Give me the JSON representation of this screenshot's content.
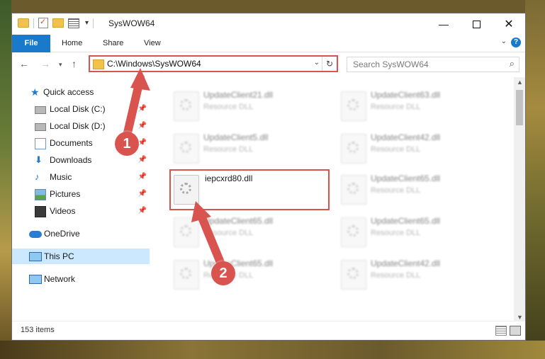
{
  "window": {
    "title": "SysWOW64"
  },
  "ribbon": {
    "tabs": [
      "File",
      "Home",
      "Share",
      "View"
    ],
    "help": "?"
  },
  "address_bar": {
    "path": "C:\\Windows\\SysWOW64"
  },
  "search": {
    "placeholder": "Search SysWOW64"
  },
  "nav_pane": {
    "items": [
      {
        "label": "Quick access",
        "icon": "star-icon",
        "pinned": false
      },
      {
        "label": "Local Disk (C:)",
        "icon": "disk-icon",
        "pinned": true
      },
      {
        "label": "Local Disk (D:)",
        "icon": "disk-icon",
        "pinned": true
      },
      {
        "label": "Documents",
        "icon": "document-icon",
        "pinned": true
      },
      {
        "label": "Downloads",
        "icon": "download-icon",
        "pinned": true
      },
      {
        "label": "Music",
        "icon": "music-icon",
        "pinned": true
      },
      {
        "label": "Pictures",
        "icon": "pictures-icon",
        "pinned": true
      },
      {
        "label": "Videos",
        "icon": "videos-icon",
        "pinned": true
      },
      {
        "label": "OneDrive",
        "icon": "cloud-icon",
        "pinned": false
      },
      {
        "label": "This PC",
        "icon": "computer-icon",
        "pinned": false,
        "selected": true
      },
      {
        "label": "Network",
        "icon": "network-icon",
        "pinned": false
      }
    ]
  },
  "files": [
    {
      "name": "UpdateClient21.dll",
      "type": "Resource DLL"
    },
    {
      "name": "UpdateClient63.dll",
      "type": "Resource DLL"
    },
    {
      "name": "UpdateClient5.dll",
      "type": "Resource DLL"
    },
    {
      "name": "UpdateClient42.dll",
      "type": "Resource DLL"
    },
    {
      "name": "iepcxrd80.dll",
      "type": ""
    },
    {
      "name": "UpdateClient65.dll",
      "type": "Resource DLL"
    },
    {
      "name": "UpdateClient65.dll",
      "type": "Resource DLL"
    },
    {
      "name": "UpdateClient65.dll",
      "type": "Resource DLL"
    },
    {
      "name": "UpdateClient65.dll",
      "type": "Resource DLL"
    },
    {
      "name": "UpdateClient42.dll",
      "type": "Resource DLL"
    }
  ],
  "status": {
    "item_count": "153 items"
  },
  "annotations": {
    "step1": "1",
    "step2": "2",
    "color": "#d9534f"
  }
}
